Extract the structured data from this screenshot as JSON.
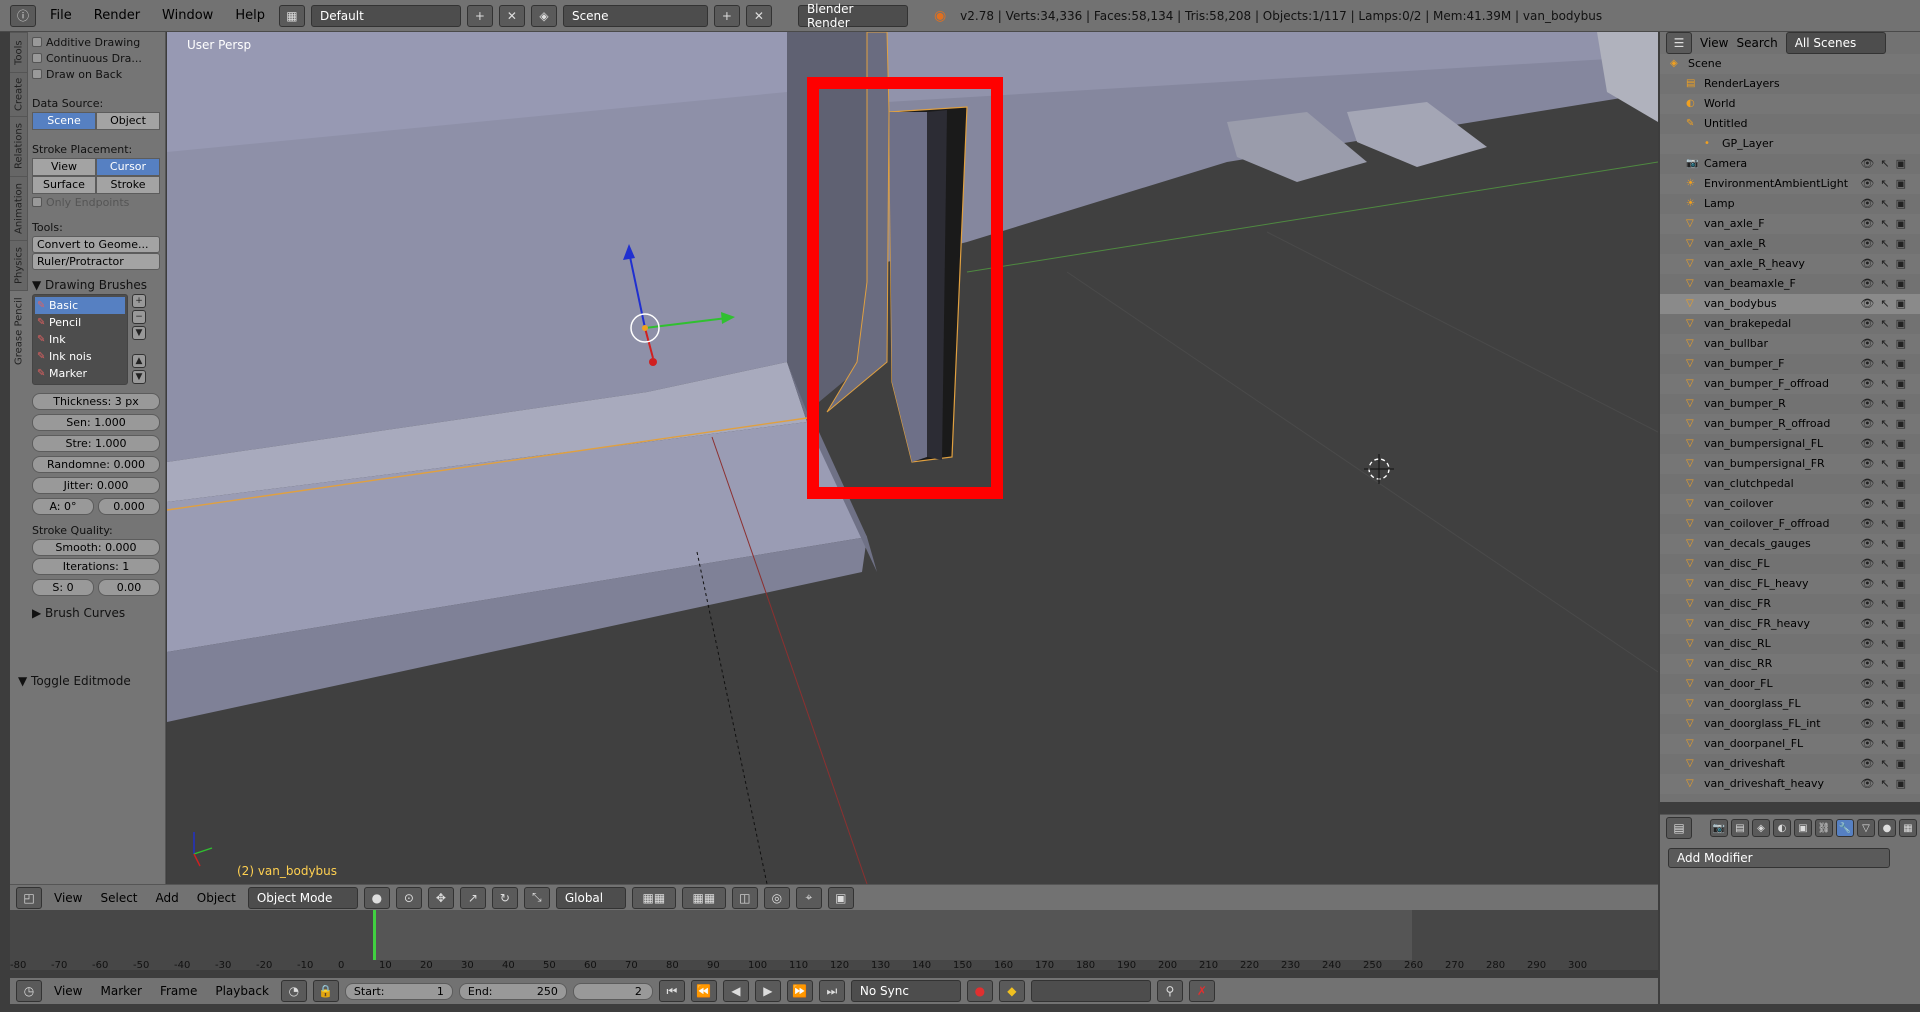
{
  "menu": [
    "File",
    "Render",
    "Window",
    "Help"
  ],
  "screen_layout": "Default",
  "scene": "Scene",
  "render_engine": "Blender Render",
  "stats": "v2.78 | Verts:34,336 | Faces:58,134 | Tris:58,208 | Objects:1/117 | Lamps:0/2 | Mem:41.39M | van_bodybus",
  "tool_tabs": [
    "Tools",
    "Create",
    "Relations",
    "Animation",
    "Physics",
    "Grease Pencil"
  ],
  "tools": {
    "additive": "Additive Drawing",
    "continuous": "Continuous Dra...",
    "draw_back": "Draw on Back",
    "data_source_label": "Data Source:",
    "data_source": [
      "Scene",
      "Object"
    ],
    "stroke_placement_label": "Stroke Placement:",
    "stroke_placement": [
      "View",
      "Cursor",
      "Surface",
      "Stroke"
    ],
    "only_endpoints": "Only Endpoints",
    "tools_label": "Tools:",
    "convert": "Convert to Geome...",
    "ruler": "Ruler/Protractor",
    "drawing_brushes": "Drawing Brushes",
    "brushes": [
      "Basic",
      "Pencil",
      "Ink",
      "Ink nois",
      "Marker"
    ],
    "thickness": "Thickness:  3 px",
    "sen": "Sen: 1.000",
    "stre": "Stre: 1.000",
    "randomne": "Randomne: 0.000",
    "jitter": "Jitter:     0.000",
    "a": "A: 0°",
    "a_val": "0.000",
    "stroke_quality": "Stroke Quality:",
    "smooth": "Smooth:  0.000",
    "iterations": "Iterations:      1",
    "s": "S: 0",
    "s_val": "0.00",
    "brush_curves": "Brush Curves",
    "toggle_editmode": "Toggle Editmode"
  },
  "viewport": {
    "persp": "User Persp",
    "object_name": "(2) van_bodybus"
  },
  "vp_menu": [
    "View",
    "Select",
    "Add",
    "Object"
  ],
  "mode": "Object Mode",
  "orientation": "Global",
  "timeline": {
    "ticks": [
      "-80",
      "-70",
      "-60",
      "-50",
      "-40",
      "-30",
      "-20",
      "-10",
      "0",
      "10",
      "20",
      "30",
      "40",
      "50",
      "60",
      "70",
      "80",
      "90",
      "100",
      "110",
      "120",
      "130",
      "140",
      "150",
      "160",
      "170",
      "180",
      "190",
      "200",
      "210",
      "220",
      "230",
      "240",
      "250",
      "260",
      "270",
      "280",
      "290",
      "300"
    ],
    "menu": [
      "View",
      "Marker",
      "Frame",
      "Playback"
    ],
    "start": "Start:",
    "start_val": "1",
    "end": "End:",
    "end_val": "250",
    "current": "2",
    "sync": "No Sync"
  },
  "outliner_menu": [
    "View",
    "Search",
    "All Scenes"
  ],
  "outliner_rows": [
    "Scene",
    "RenderLayers",
    "World",
    "Untitled",
    "GP_Layer",
    "Camera",
    "EnvironmentAmbientLight",
    "Lamp",
    "van_axle_F",
    "van_axle_R",
    "van_axle_R_heavy",
    "van_beamaxle_F",
    "van_bodybus",
    "van_brakepedal",
    "van_bullbar",
    "van_bumper_F",
    "van_bumper_F_offroad",
    "van_bumper_R",
    "van_bumper_R_offroad",
    "van_bumpersignal_FL",
    "van_bumpersignal_FR",
    "van_clutchpedal",
    "van_coilover",
    "van_coilover_F_offroad",
    "van_decals_gauges",
    "van_disc_FL",
    "van_disc_FL_heavy",
    "van_disc_FR",
    "van_disc_FR_heavy",
    "van_disc_RL",
    "van_disc_RR",
    "van_door_FL",
    "van_doorglass_FL",
    "van_doorglass_FL_int",
    "van_doorpanel_FL",
    "van_driveshaft",
    "van_driveshaft_heavy"
  ],
  "properties": {
    "add_modifier": "Add Modifier"
  }
}
